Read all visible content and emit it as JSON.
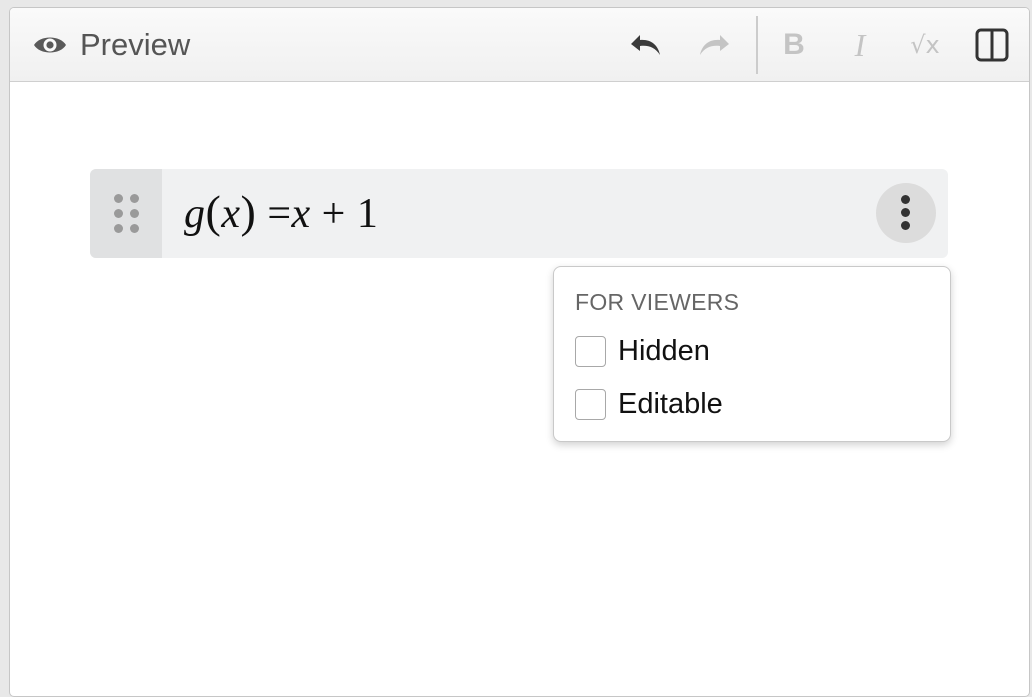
{
  "toolbar": {
    "title": "Preview",
    "icons": {
      "eye": "eye-icon",
      "undo": "undo-icon",
      "redo": "redo-icon",
      "bold": "bold-icon",
      "italic": "italic-icon",
      "math": "sqrt-x-icon",
      "layout": "split-view-icon"
    },
    "bold_glyph": "B",
    "italic_glyph": "I",
    "math_glyph": "√x"
  },
  "expression": {
    "func": "g",
    "var": "x",
    "rhs_var": "x",
    "op": "+",
    "const": "1"
  },
  "popover": {
    "section_title": "FOR VIEWERS",
    "options": [
      {
        "label": "Hidden",
        "checked": false
      },
      {
        "label": "Editable",
        "checked": false
      }
    ]
  },
  "colors": {
    "toolbar_text": "#555555",
    "disabled_icon": "#c4c4c4",
    "row_bg": "#f0f1f2"
  }
}
